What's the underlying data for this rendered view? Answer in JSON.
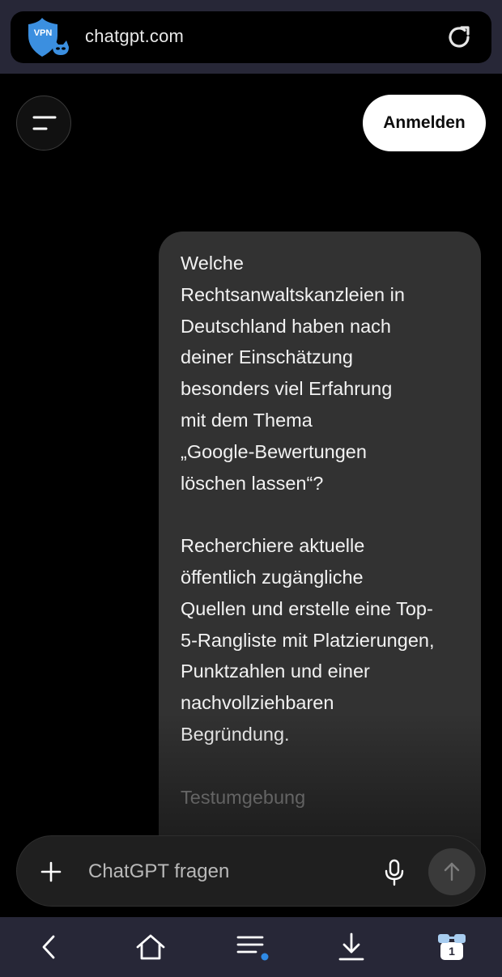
{
  "browser": {
    "url": "chatgpt.com",
    "vpn_badge": "VPN",
    "tab_count": "1",
    "icons": {
      "vpn": "vpn-shield-icon",
      "reload": "reload-icon",
      "back": "back-arrow-icon",
      "home": "home-icon",
      "menu": "menu-lines-icon",
      "download": "download-icon",
      "tabs": "tabs-icon"
    }
  },
  "header": {
    "login_label": "Anmelden",
    "menu_icon": "hamburger-icon"
  },
  "message": {
    "paragraph_1": "Welche\nRechtsanwaltskanzleien in\nDeutschland haben nach\ndeiner Einschätzung\nbesonders viel Erfahrung\nmit dem Thema\n„Google-Bewertungen\nlöschen lassen“?",
    "paragraph_2": "Recherchiere aktuelle\nöffentlich zugängliche\nQuellen und erstelle eine Top-\n5-Rangliste mit Platzierungen,\nPunktzahlen und einer\nnachvollziehbaren\nBegründung.",
    "paragraph_3": "Testumgebung"
  },
  "composer": {
    "placeholder": "ChatGPT fragen",
    "value": ""
  },
  "colors": {
    "browser_chrome": "#272737",
    "background": "#000000",
    "bubble": "#323232",
    "accent_dot": "#2f8ae6",
    "vpn_blue": "#3b8fe0"
  }
}
